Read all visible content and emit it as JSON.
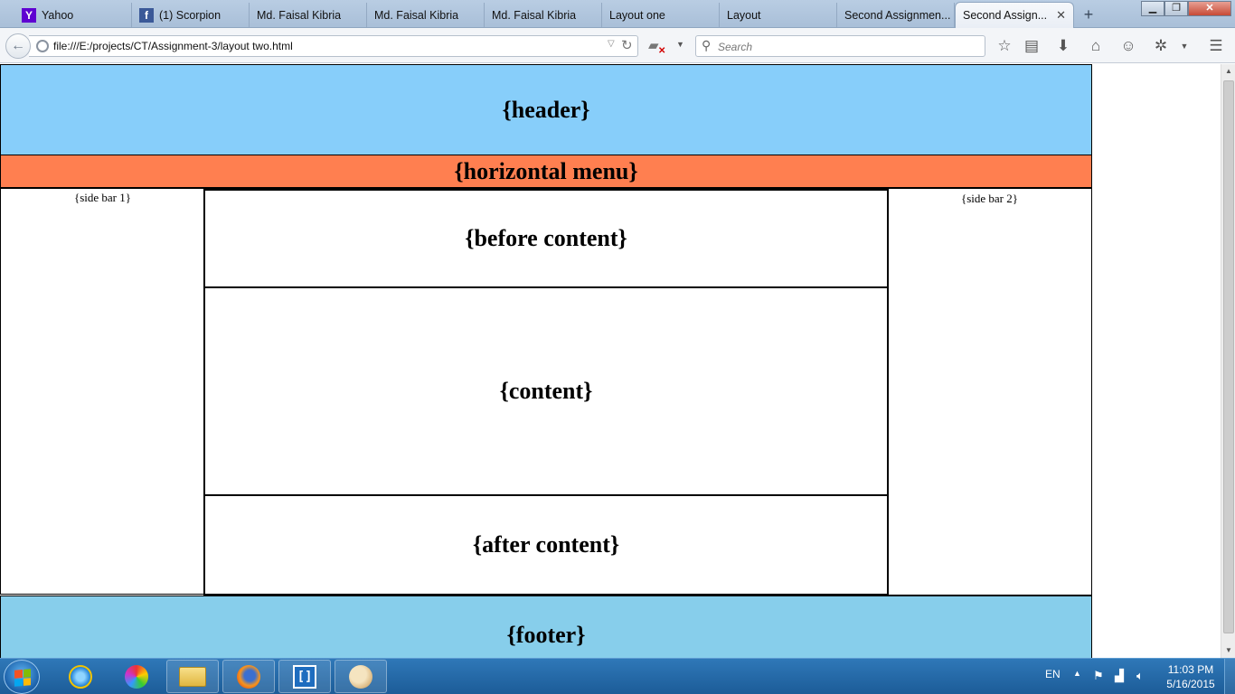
{
  "browser": {
    "tabs": [
      {
        "label": "Yahoo",
        "icon": "yahoo-icon"
      },
      {
        "label": "(1) Scorpion",
        "icon": "facebook-icon"
      },
      {
        "label": "Md. Faisal Kibria"
      },
      {
        "label": "Md. Faisal Kibria"
      },
      {
        "label": "Md. Faisal Kibria"
      },
      {
        "label": "Layout one"
      },
      {
        "label": "Layout"
      },
      {
        "label": "Second Assignmen..."
      },
      {
        "label": "Second Assign...",
        "active": true
      }
    ],
    "url": "file:///E:/projects/CT/Assignment-3/layout two.html",
    "search_placeholder": "Search"
  },
  "page": {
    "header": "{header}",
    "menu": "{horizontal menu}",
    "sidebar1": "{side bar 1}",
    "sidebar2": "{side bar 2}",
    "before_content": "{before content}",
    "content": "{content}",
    "after_content": "{after content}",
    "footer": "{footer}"
  },
  "colors": {
    "header_bg": "#87cefa",
    "menu_bg": "#ff7f50",
    "footer_bg": "#87ceeb"
  },
  "taskbar": {
    "language": "EN",
    "time": "11:03 PM",
    "date": "5/16/2015",
    "apps": [
      "internet-explorer-icon",
      "paint-icon",
      "file-explorer-icon",
      "firefox-icon",
      "brackets-icon",
      "paint-palette-icon"
    ]
  }
}
